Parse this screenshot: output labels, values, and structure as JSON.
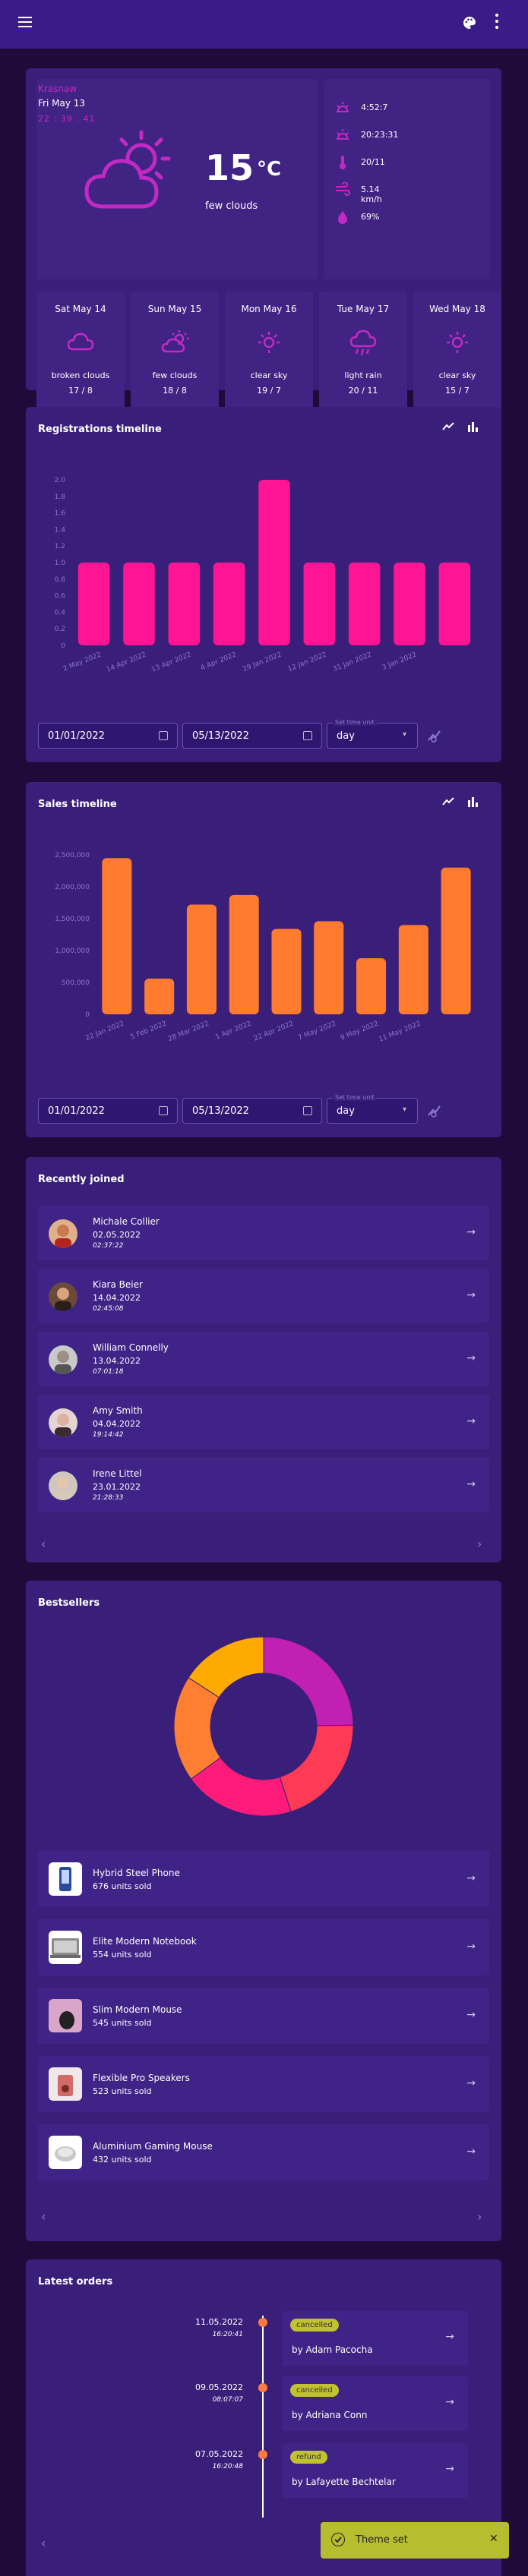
{
  "weather": {
    "city": "Krasnaw",
    "date": "Fri May 13",
    "time": "22 : 39 : 41",
    "temp": "15",
    "unit": "°C",
    "desc": "few clouds",
    "details": [
      {
        "icon": "sunrise-icon",
        "value": "4:52:7"
      },
      {
        "icon": "sunset-icon",
        "value": "20:23:31"
      },
      {
        "icon": "thermometer-icon",
        "value": "20/11"
      },
      {
        "icon": "wind-icon",
        "value": "5.14 km/h"
      },
      {
        "icon": "humidity-icon",
        "value": "69%"
      }
    ],
    "forecast": [
      {
        "day": "Sat May 14",
        "cond": "broken clouds",
        "temps": "17 / 8",
        "icon": "cloud-icon"
      },
      {
        "day": "Sun May 15",
        "cond": "few clouds",
        "temps": "18 / 8",
        "icon": "cloud-sun-icon"
      },
      {
        "day": "Mon May 16",
        "cond": "clear sky",
        "temps": "19 / 7",
        "icon": "sun-icon"
      },
      {
        "day": "Tue May 17",
        "cond": "light rain",
        "temps": "20 / 11",
        "icon": "rain-icon"
      },
      {
        "day": "Wed May 18",
        "cond": "clear sky",
        "temps": "15 / 7",
        "icon": "sun-icon"
      }
    ]
  },
  "registrations": {
    "title": "Registrations timeline",
    "date_from": "01/01/2022",
    "date_to": "05/13/2022",
    "timespan_label": "Set time unit",
    "timespan": "day"
  },
  "sales": {
    "title": "Sales timeline",
    "date_from": "01/01/2022",
    "date_to": "05/13/2022",
    "timespan_label": "Set time unit",
    "timespan": "day"
  },
  "chart_data": [
    {
      "type": "bar",
      "title": "Registrations timeline",
      "categories": [
        "2 May 2022",
        "14 Apr 2022",
        "13 Apr 2022",
        "4 Apr 2022",
        "29 Jan 2022",
        "12 Jan 2022",
        "31 Jan 2022",
        "3 Jan 2022",
        ""
      ],
      "values": [
        1,
        1,
        1,
        1,
        2,
        1,
        1,
        1,
        1
      ],
      "ylim": [
        0,
        2
      ],
      "yticks": [
        "0",
        "0.2",
        "0.4",
        "0.6",
        "0.8",
        "1.0",
        "1.2",
        "1.4",
        "1.6",
        "1.8",
        "2.0"
      ],
      "color": "#ff1493"
    },
    {
      "type": "bar",
      "title": "Sales timeline",
      "categories": [
        "22 Jan 2022",
        "5 Feb 2022",
        "28 Mar 2022",
        "1 Apr 2022",
        "22 Apr 2022",
        "7 May 2022",
        "9 May 2022",
        "11 May 2022",
        "",
        ""
      ],
      "values": [
        2450000,
        560000,
        1720000,
        1870000,
        1340000,
        1460000,
        880000,
        1400000,
        2300000
      ],
      "ylim": [
        0,
        2500000
      ],
      "yticks": [
        "0",
        "500,000",
        "1,000,000",
        "1,500,000",
        "2,000,000",
        "2,500,000"
      ],
      "color": "#ff7b2f"
    },
    {
      "type": "pie",
      "title": "Bestsellers",
      "labels": [
        "Hybrid Steel Phone",
        "Elite Modern Notebook",
        "Slim Modern Mouse",
        "Flexible Pro Speakers",
        "Aluminium Gaming Mouse"
      ],
      "values": [
        676,
        554,
        545,
        523,
        432
      ],
      "colors": [
        "#c21fb3",
        "#ff3a55",
        "#ff1b7a",
        "#ff7f32",
        "#ffaa00"
      ]
    }
  ],
  "recently_joined": {
    "title": "Recently joined",
    "users": [
      {
        "name": "Michale Collier",
        "date": "02.05.2022",
        "time": "02:37:22"
      },
      {
        "name": "Kiara Beier",
        "date": "14.04.2022",
        "time": "02:45:08"
      },
      {
        "name": "William Connelly",
        "date": "13.04.2022",
        "time": "07:01:18"
      },
      {
        "name": "Amy Smith",
        "date": "04.04.2022",
        "time": "19:14:42"
      },
      {
        "name": "Irene Littel",
        "date": "23.01.2022",
        "time": "21:28:33"
      }
    ]
  },
  "bestsellers": {
    "title": "Bestsellers",
    "items": [
      {
        "name": "Hybrid Steel Phone",
        "units": "676 units sold"
      },
      {
        "name": "Elite Modern Notebook",
        "units": "554 units sold"
      },
      {
        "name": "Slim Modern Mouse",
        "units": "545 units sold"
      },
      {
        "name": "Flexible Pro Speakers",
        "units": "523 units sold"
      },
      {
        "name": "Aluminium Gaming Mouse",
        "units": "432 units sold"
      }
    ]
  },
  "orders": {
    "title": "Latest orders",
    "items": [
      {
        "date": "11.05.2022",
        "time": "16:20:41",
        "status": "cancelled",
        "by": "by Adam Pacocha"
      },
      {
        "date": "09.05.2022",
        "time": "08:07:07",
        "status": "cancelled",
        "by": "by Adriana Conn"
      },
      {
        "date": "07.05.2022",
        "time": "16:20:48",
        "status": "refund",
        "by": "by Lafayette Bechtelar"
      }
    ]
  },
  "toast": {
    "text": "Theme set"
  },
  "ui": {
    "prev": "‹",
    "next": "›",
    "arrow": "→",
    "close": "✕"
  }
}
